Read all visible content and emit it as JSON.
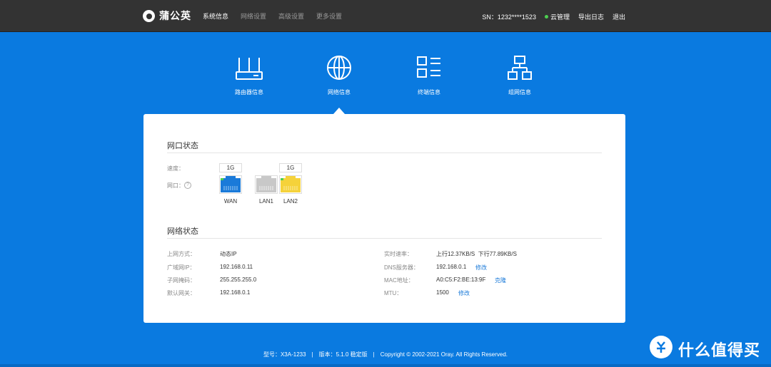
{
  "brand": {
    "name": "蒲公英"
  },
  "nav": [
    {
      "label": "系统信息",
      "active": true
    },
    {
      "label": "网络设置",
      "active": false
    },
    {
      "label": "高级设置",
      "active": false
    },
    {
      "label": "更多设置",
      "active": false
    }
  ],
  "header_right": {
    "sn": "SN：1232****1523",
    "cloud": "云管理",
    "export": "导出日志",
    "logout": "退出"
  },
  "features": [
    {
      "label": "路由器信息",
      "icon": "router-icon"
    },
    {
      "label": "网络信息",
      "icon": "globe-icon",
      "active": true
    },
    {
      "label": "终端信息",
      "icon": "device-list-icon"
    },
    {
      "label": "组网信息",
      "icon": "network-topology-icon"
    }
  ],
  "port_status": {
    "title": "网口状态",
    "speed_label": "速度：",
    "port_label": "网口：",
    "ports": [
      {
        "name": "WAN",
        "speed": "1G",
        "color": "#1a7ad9"
      },
      {
        "name": "LAN1",
        "speed": "",
        "color": "#c8c8c8"
      },
      {
        "name": "LAN2",
        "speed": "1G",
        "color": "#f5d23a"
      }
    ]
  },
  "network_status": {
    "title": "网络状态",
    "left": [
      {
        "label": "上网方式：",
        "value": "动态IP"
      },
      {
        "label": "广域网IP：",
        "value": "192.168.0.11"
      },
      {
        "label": "子网掩码：",
        "value": "255.255.255.0"
      },
      {
        "label": "默认网关：",
        "value": "192.168.0.1"
      }
    ],
    "right": [
      {
        "label": "实时速率：",
        "value": "上行12.37KB/S  下行77.89KB/S"
      },
      {
        "label": "DNS服务器：",
        "value": "192.168.0.1",
        "action": "修改"
      },
      {
        "label": "MAC地址：",
        "value": "A0:C5:F2:BE:13:9F",
        "action": "克隆"
      },
      {
        "label": "MTU：",
        "value": "1500",
        "action": "修改"
      }
    ]
  },
  "footer": {
    "model": "型号：X3A-1233",
    "version": "版本：5.1.0 稳定版",
    "copyright": "Copyright © 2002-2021 Oray. All Rights Reserved."
  },
  "watermark": {
    "text": "什么值得买",
    "icon": "watermark-logo-icon"
  },
  "colors": {
    "background": "#0a7ae0",
    "topbar": "#333333",
    "link": "#1a7ad9",
    "cloud_dot": "#4ccf50"
  }
}
